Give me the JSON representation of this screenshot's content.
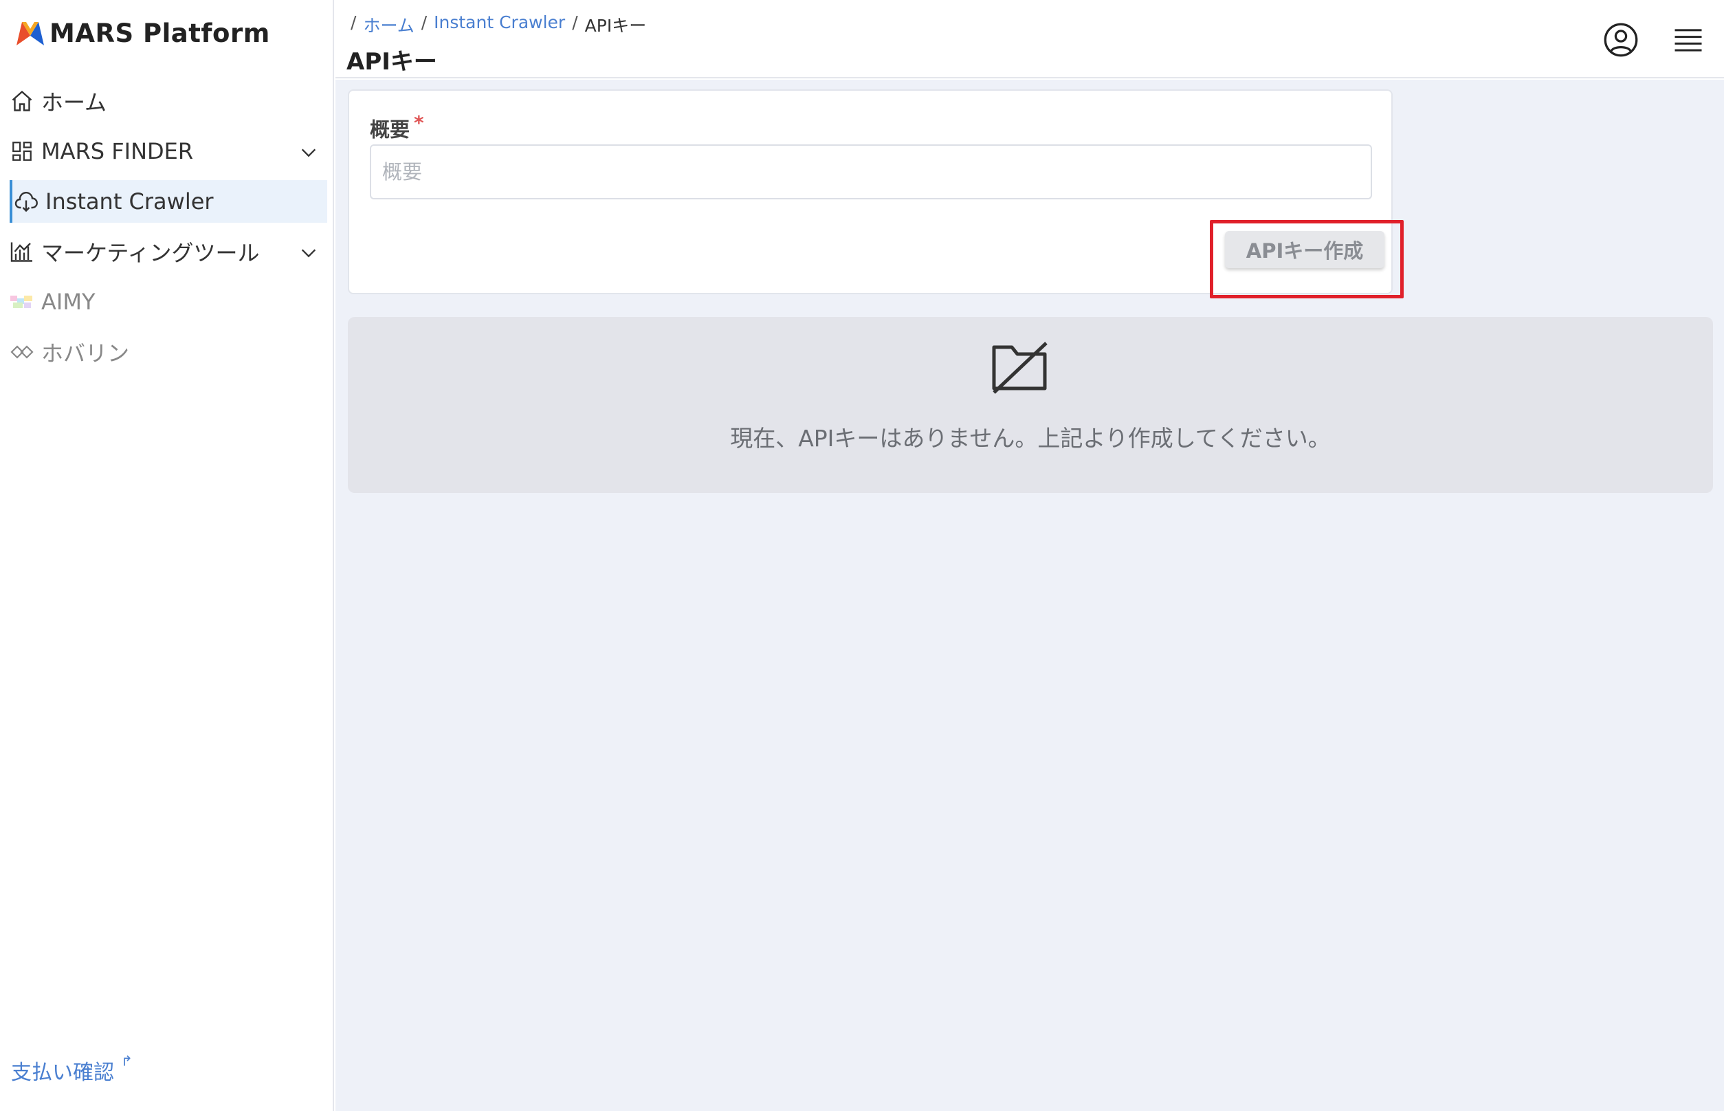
{
  "brand": {
    "name": "MARS Platform",
    "colors": {
      "m_left": "#e94e2b",
      "m_right": "#1d5fd1",
      "m_mid": "#f5a623"
    }
  },
  "sidebar": {
    "items": [
      {
        "label": "ホーム",
        "icon": "home-icon"
      },
      {
        "label": "MARS FINDER",
        "icon": "dashboard-grid-icon",
        "expandable": true
      },
      {
        "label": "Instant Crawler",
        "icon": "cloud-download-icon",
        "active": true
      },
      {
        "label": "マーケティングツール",
        "icon": "bar-chart-icon",
        "expandable": true
      },
      {
        "label": "AIMY",
        "icon": "aimy-logo-icon",
        "muted": true
      },
      {
        "label": "ホバリン",
        "icon": "link-chain-icon",
        "muted": true
      }
    ],
    "footer_link": {
      "label": "支払い確認",
      "icon": "external-link-icon"
    }
  },
  "header": {
    "breadcrumb": [
      {
        "label": "ホーム",
        "link": true
      },
      {
        "label": "Instant Crawler",
        "link": true
      },
      {
        "label": "APIキー",
        "link": false
      }
    ],
    "title": "APIキー",
    "icons": [
      "user-account-icon",
      "hamburger-menu-icon"
    ]
  },
  "form": {
    "field_label": "概要",
    "required_mark": "*",
    "input_placeholder": "概要",
    "input_value": "",
    "submit_label": "APIキー作成"
  },
  "empty_state": {
    "icon": "folder-off-icon",
    "message": "現在、APIキーはありません。上記より作成してください。"
  },
  "accent_colors": {
    "active_bg": "#eaf2fb",
    "active_border": "#3a8fd6",
    "link": "#4a7fd0",
    "highlight": "#e0202a",
    "main_bg": "#eef1f8"
  }
}
